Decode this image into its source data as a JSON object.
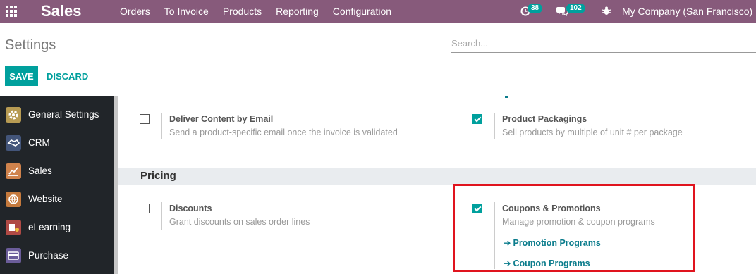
{
  "navbar": {
    "brand": "Sales",
    "menu": [
      "Orders",
      "To Invoice",
      "Products",
      "Reporting",
      "Configuration"
    ],
    "activity_count": "38",
    "messages_count": "102",
    "company": "My Company (San Francisco)"
  },
  "control_panel": {
    "title": "Settings",
    "search_placeholder": "Search...",
    "save_label": "SAVE",
    "discard_label": "DISCARD"
  },
  "sidebar": {
    "items": [
      {
        "label": "General Settings",
        "icon": "gear-icon",
        "color": "#b79b53"
      },
      {
        "label": "CRM",
        "icon": "handshake-icon",
        "color": "#43557a"
      },
      {
        "label": "Sales",
        "icon": "chart-icon",
        "color": "#d0834c"
      },
      {
        "label": "Website",
        "icon": "globe-icon",
        "color": "#c57a3d"
      },
      {
        "label": "eLearning",
        "icon": "elearning-icon",
        "color": "#b04a45"
      },
      {
        "label": "Purchase",
        "icon": "credit-card-icon",
        "color": "#6b5d9a"
      }
    ]
  },
  "settings": {
    "deliver_content": {
      "title": "Deliver Content by Email",
      "description": "Send a product-specific email once the invoice is validated",
      "checked": false
    },
    "product_packagings": {
      "title": "Product Packagings",
      "description": "Sell products by multiple of unit # per package",
      "checked": true
    },
    "pricing_section": "Pricing",
    "discounts": {
      "title": "Discounts",
      "description": "Grant discounts on sales order lines",
      "checked": false
    },
    "coupons": {
      "title": "Coupons & Promotions",
      "description": "Manage promotion & coupon programs",
      "checked": true,
      "links": [
        "Promotion Programs",
        "Coupon Programs"
      ]
    }
  },
  "colors": {
    "navbar": "#875a7b",
    "accent": "#00a09d",
    "highlight": "#e0141e"
  }
}
